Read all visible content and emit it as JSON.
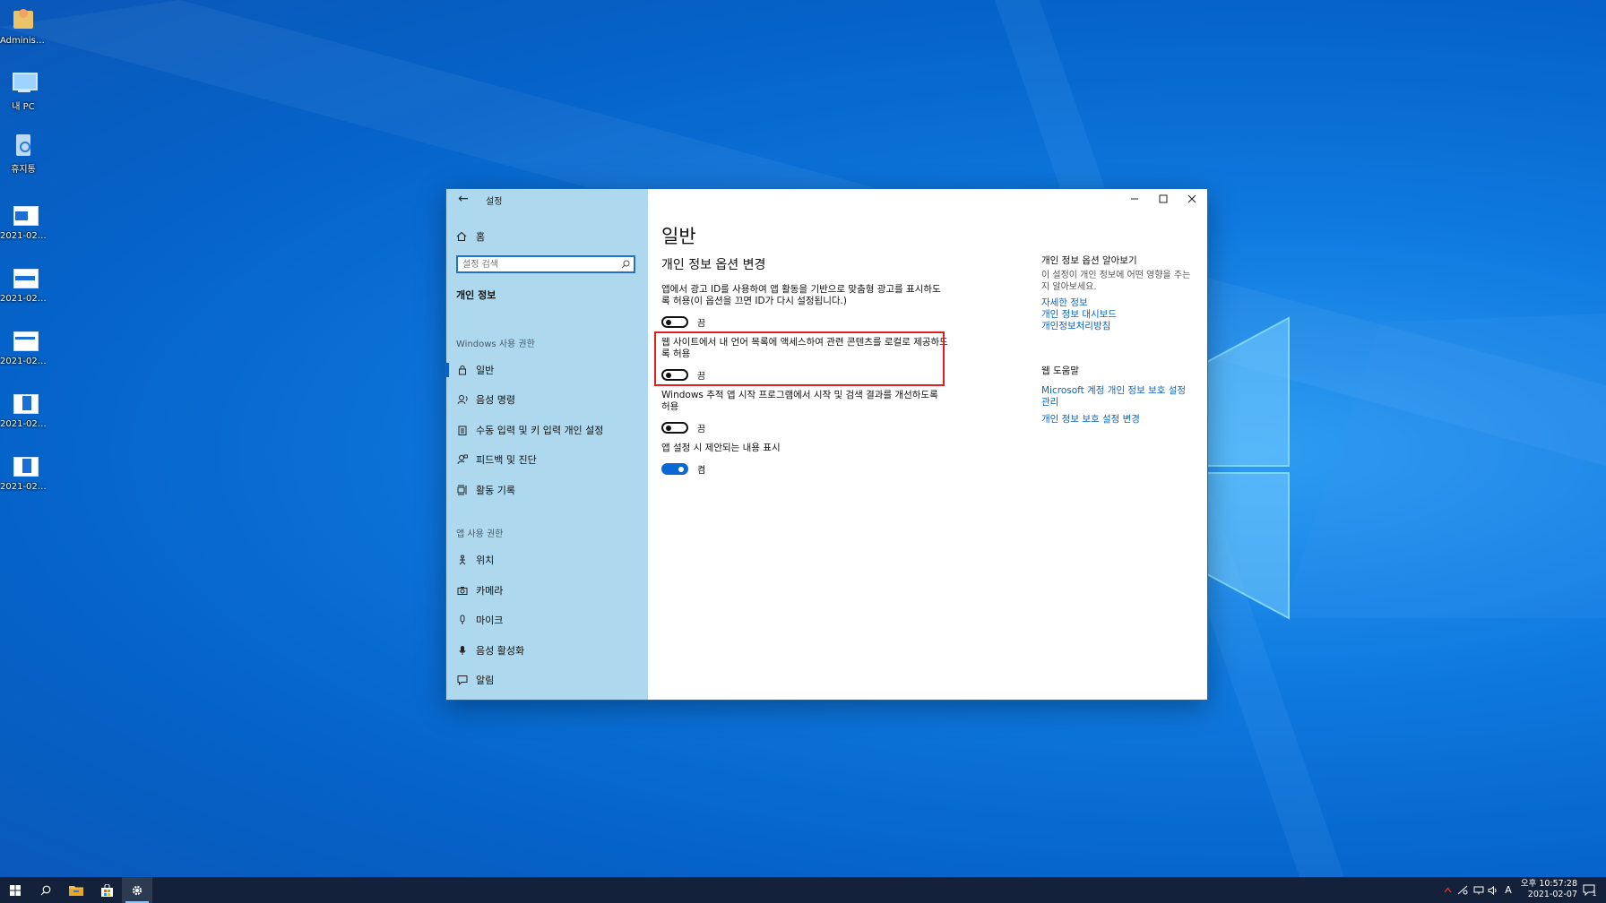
{
  "desktop": {
    "icons": [
      {
        "label": "Administra..."
      },
      {
        "label": "내 PC"
      },
      {
        "label": "휴지통"
      },
      {
        "label": "2021-02-0..."
      },
      {
        "label": "2021-02-0..."
      },
      {
        "label": "2021-02-0..."
      },
      {
        "label": "2021-02-0..."
      },
      {
        "label": "2021-02-0..."
      }
    ]
  },
  "window": {
    "app_title": "설정",
    "controls": {
      "minimize": "—",
      "maximize": "☐",
      "close": "✕"
    }
  },
  "sidebar": {
    "home_label": "홈",
    "search_placeholder": "설정 검색",
    "section_title": "개인 정보",
    "groups": [
      {
        "label": "Windows 사용 권한",
        "items": [
          {
            "label": "일반",
            "icon": "lock-icon",
            "active": true
          },
          {
            "label": "음성 명령",
            "icon": "speech-icon"
          },
          {
            "label": "수동 입력 및 키 입력 개인 설정",
            "icon": "clipboard-icon"
          },
          {
            "label": "피드백 및 진단",
            "icon": "feedback-icon"
          },
          {
            "label": "활동 기록",
            "icon": "timeline-icon"
          }
        ]
      },
      {
        "label": "앱 사용 권한",
        "items": [
          {
            "label": "위치",
            "icon": "location-icon"
          },
          {
            "label": "카메라",
            "icon": "camera-icon"
          },
          {
            "label": "마이크",
            "icon": "microphone-icon"
          },
          {
            "label": "음성 활성화",
            "icon": "voice-activation-icon"
          },
          {
            "label": "알림",
            "icon": "notification-icon"
          }
        ]
      }
    ]
  },
  "main": {
    "page_title": "일반",
    "section_title": "개인 정보 옵션 변경",
    "options": [
      {
        "desc": "앱에서 광고 ID를 사용하여 앱 활동을 기반으로 맞춤형 광고를 표시하도록 허용(이 옵션을 끄면 ID가 다시 설정됩니다.)",
        "state_label": "끔",
        "on": false
      },
      {
        "desc": "웹 사이트에서 내 언어 목록에 액세스하여 관련 콘텐츠를 로컬로 제공하도록 허용",
        "state_label": "끔",
        "on": false
      },
      {
        "desc": "Windows 추적 앱 시작 프로그램에서 시작 및 검색 결과를 개선하도록 허용",
        "state_label": "끔",
        "on": false
      },
      {
        "desc": "앱 설정 시 제안되는 내용 표시",
        "state_label": "켬",
        "on": true
      }
    ]
  },
  "aside": {
    "learn_heading": "개인 정보 옵션 알아보기",
    "learn_text": "이 설정이 개인 정보에 어떤 영향을 주는지 알아보세요.",
    "learn_links": [
      "자세한 정보",
      "개인 정보 대시보드",
      "개인정보처리방침"
    ],
    "help_heading": "웹 도움말",
    "help_links": [
      "Microsoft 계정 개인 정보 보호 설정 관리",
      "개인 정보 보호 설정 변경"
    ]
  },
  "taskbar": {
    "clock_time": "오후 10:57:28",
    "clock_date": "2021-02-07",
    "ime_indicator": "A",
    "notification_count": "1"
  },
  "colors": {
    "accent": "#0a68d6",
    "sidebar_bg": "#add8ee",
    "highlight": "#e02020",
    "link": "#0a66c2",
    "taskbar": "#13223a"
  }
}
